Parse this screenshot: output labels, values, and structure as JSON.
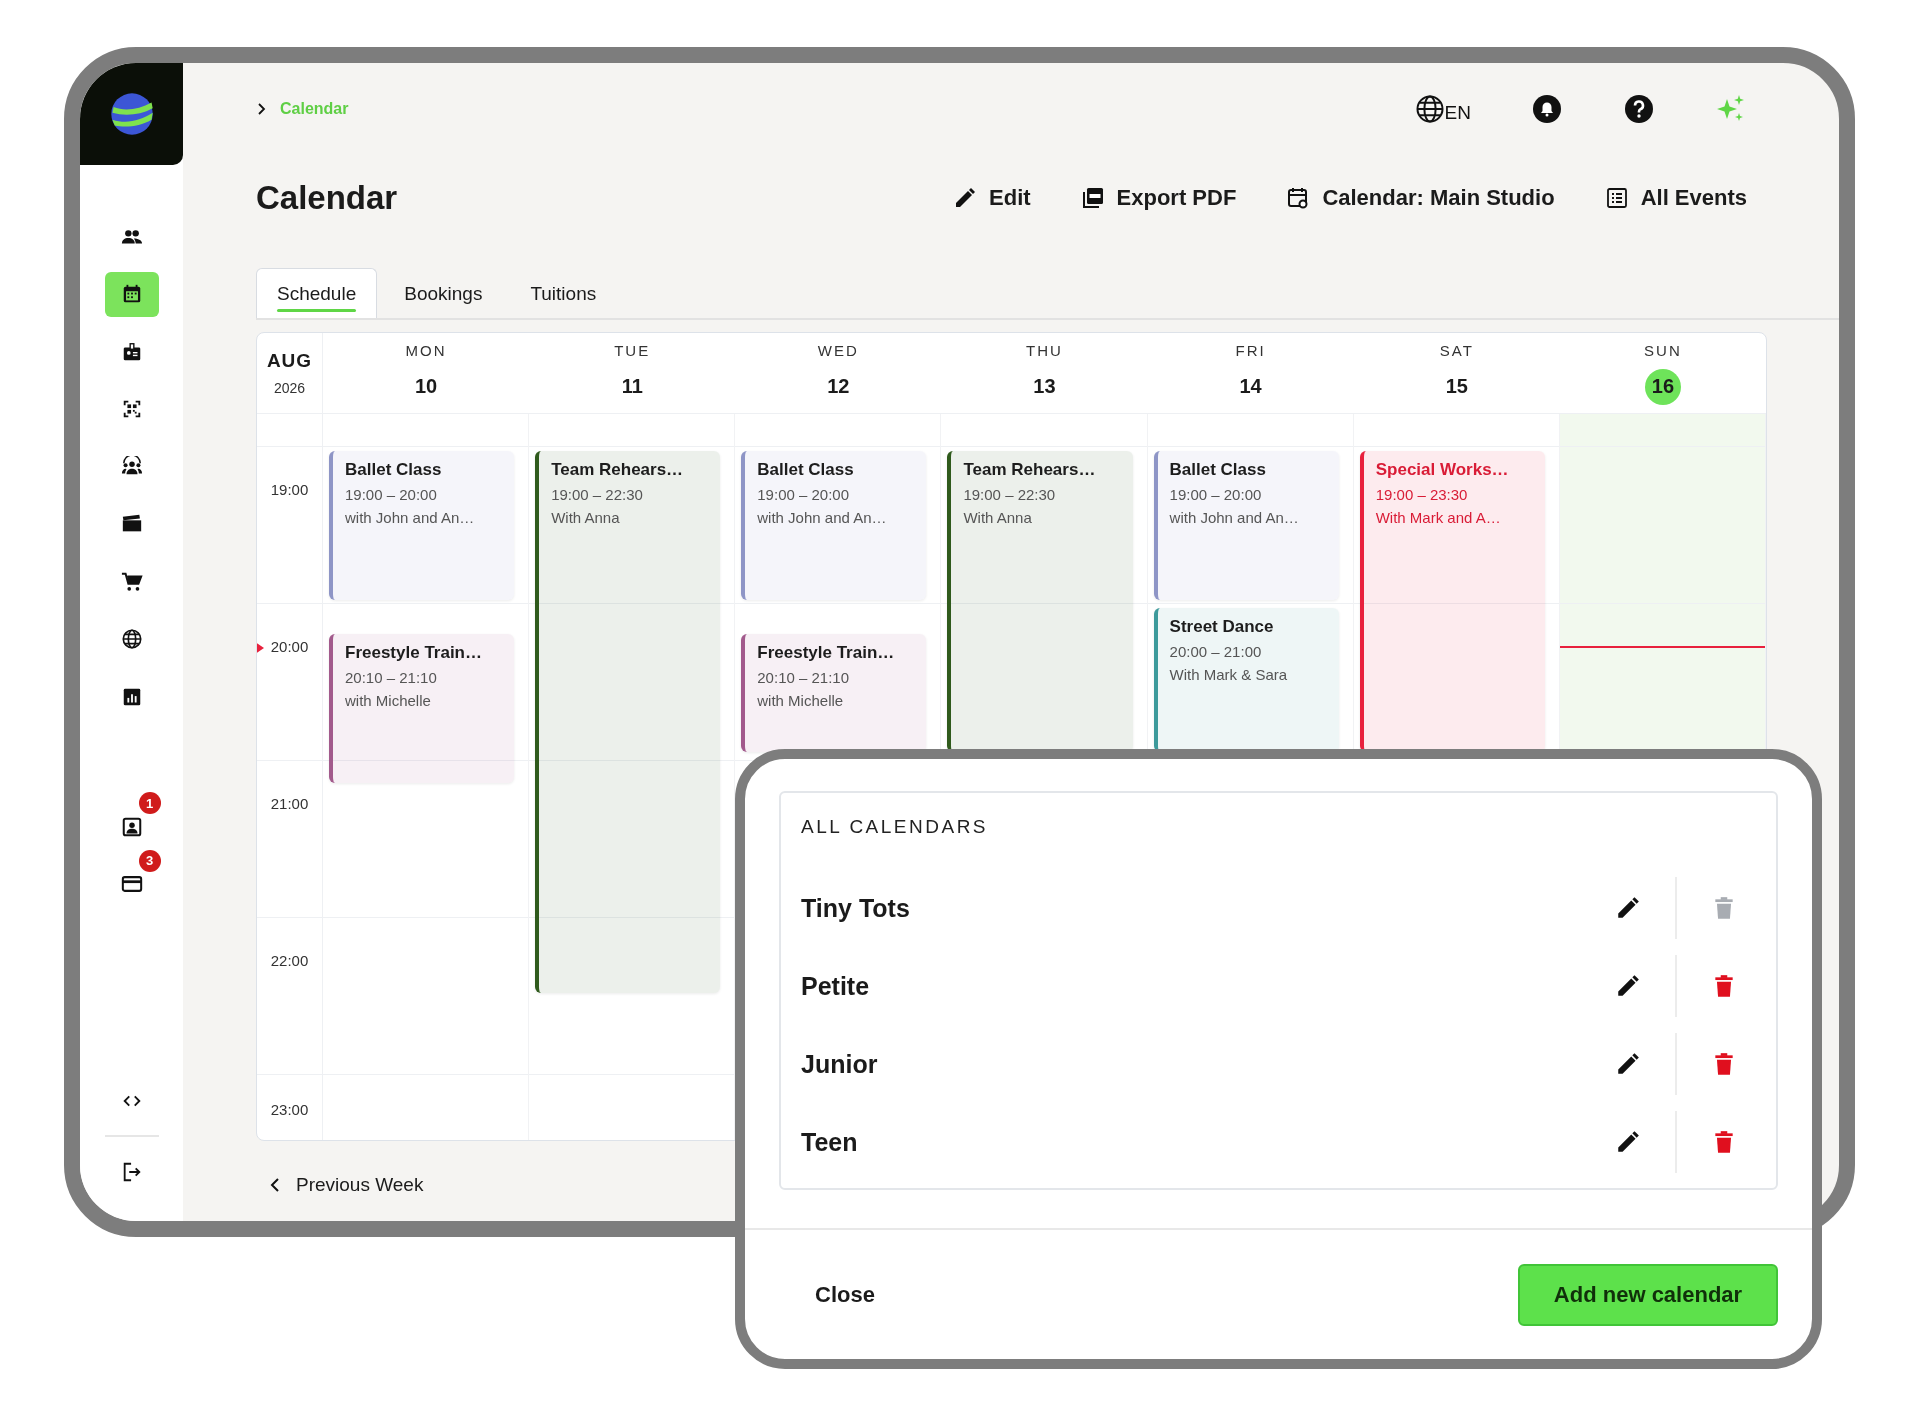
{
  "sidebar": {
    "items": [
      {
        "kind": "people",
        "selected": false
      },
      {
        "kind": "calendar",
        "selected": true
      },
      {
        "kind": "id-badge",
        "selected": false
      },
      {
        "kind": "qr",
        "selected": false
      },
      {
        "kind": "group",
        "selected": false
      },
      {
        "kind": "clapper",
        "selected": false
      },
      {
        "kind": "cart",
        "selected": false
      },
      {
        "kind": "globe",
        "selected": false
      },
      {
        "kind": "chart",
        "selected": false
      },
      {
        "kind": "contact",
        "selected": false,
        "badge": "1"
      },
      {
        "kind": "card",
        "selected": false,
        "badge": "3"
      }
    ],
    "bottom": [
      {
        "kind": "code",
        "selected": false
      },
      {
        "kind": "logout",
        "selected": false
      }
    ]
  },
  "breadcrumb": "Calendar",
  "language": "EN",
  "title": "Calendar",
  "toolbar": [
    {
      "kind": "edit",
      "label": "Edit"
    },
    {
      "kind": "pdf",
      "label": "Export PDF"
    },
    {
      "kind": "calendar",
      "label": "Calendar: Main Studio"
    },
    {
      "kind": "list",
      "label": "All Events"
    }
  ],
  "tabs": [
    {
      "label": "Schedule",
      "selected": true
    },
    {
      "label": "Bookings",
      "selected": false
    },
    {
      "label": "Tuitions",
      "selected": false
    }
  ],
  "calendar": {
    "month": "AUG",
    "year": "2026",
    "hours": [
      "19:00",
      "20:00",
      "21:00",
      "22:00",
      "23:00"
    ],
    "days": [
      {
        "weekday": "MON",
        "date": "10",
        "today": false,
        "events": [
          {
            "title": "Ballet Class",
            "time": "19:00 – 20:00",
            "people": "with John and An…",
            "color": "#8e95c6",
            "emphasis": false
          },
          {
            "title": "Freestyle Train…",
            "time": "20:10 – 21:10",
            "people": "with Michelle",
            "color": "#a25a8c",
            "emphasis": false
          }
        ]
      },
      {
        "weekday": "TUE",
        "date": "11",
        "today": false,
        "events": [
          {
            "title": "Team Rehears…",
            "time": "19:00 – 22:30",
            "people": "With Anna",
            "color": "#2f5a1c",
            "emphasis": false
          }
        ]
      },
      {
        "weekday": "WED",
        "date": "12",
        "today": false,
        "events": [
          {
            "title": "Ballet Class",
            "time": "19:00 – 20:00",
            "people": "with John and An…",
            "color": "#8e95c6",
            "emphasis": false
          },
          {
            "title": "Freestyle Train…",
            "time": "20:10 – 21:10",
            "people": "with Michelle",
            "color": "#a25a8c",
            "emphasis": false
          }
        ]
      },
      {
        "weekday": "THU",
        "date": "13",
        "today": false,
        "events": [
          {
            "title": "Team Rehears…",
            "time": "19:00 – 22:30",
            "people": "With Anna",
            "color": "#2f5a1c",
            "emphasis": false
          }
        ]
      },
      {
        "weekday": "FRI",
        "date": "14",
        "today": false,
        "events": [
          {
            "title": "Ballet Class",
            "time": "19:00 – 20:00",
            "people": "with John and An…",
            "color": "#8e95c6",
            "emphasis": false
          },
          {
            "title": "Street Dance",
            "time": "20:00 – 21:00",
            "people": "With Mark & Sara",
            "color": "#3d9a9b",
            "emphasis": false
          }
        ]
      },
      {
        "weekday": "SAT",
        "date": "15",
        "today": false,
        "events": [
          {
            "title": "Special Works…",
            "time": "19:00 – 23:30",
            "people": "With Mark and A…",
            "color": "#e8213d",
            "emphasis": true
          }
        ]
      },
      {
        "weekday": "SUN",
        "date": "16",
        "today": true
      }
    ]
  },
  "pagination": {
    "previous": "Previous Week"
  },
  "dialog": {
    "heading": "ALL CALENDARS",
    "calendars": [
      {
        "name": "Tiny Tots",
        "deletable": false
      },
      {
        "name": "Petite",
        "deletable": true
      },
      {
        "name": "Junior",
        "deletable": true
      },
      {
        "name": "Teen",
        "deletable": true
      }
    ],
    "close": "Close",
    "add": "Add new calendar"
  }
}
